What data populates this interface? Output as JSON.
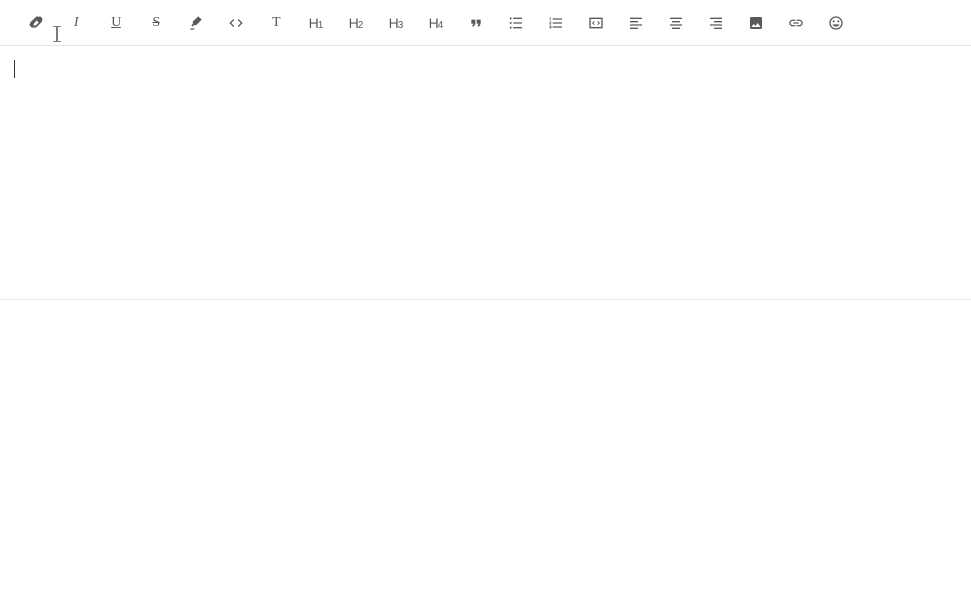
{
  "toolbar": {
    "eraser": "",
    "italic": "I",
    "underline": "U",
    "strikethrough": "S",
    "highlight": "",
    "code": "",
    "text": "T",
    "h1_main": "H",
    "h1_sub": "1",
    "h2_main": "H",
    "h2_sub": "2",
    "h3_main": "H",
    "h3_sub": "3",
    "h4_main": "H",
    "h4_sub": "4",
    "quote": "",
    "ul": "",
    "ol": "",
    "codeblock": "",
    "align_left": "",
    "align_center": "",
    "align_right": "",
    "image": "",
    "link": "",
    "emoji": ""
  },
  "editor": {
    "content": ""
  }
}
